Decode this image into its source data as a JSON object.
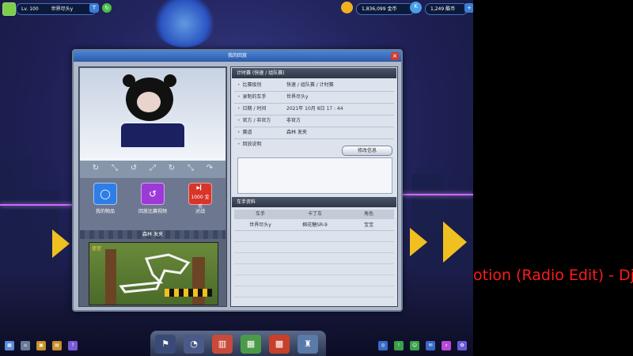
{
  "topbar": {
    "level": "Lv. 100",
    "player_name": "世界尽头y",
    "title_badge": "T",
    "gold": "1,836,099 金币",
    "kcoin": "1,249 酷币",
    "plus": "+"
  },
  "dialog": {
    "title": "我的回放",
    "close": "×",
    "actions": [
      {
        "label": "我的物品",
        "icon": "item-box-icon",
        "color": "#2f7ee6"
      },
      {
        "label": "回放比赛视频",
        "icon": "replay-icon",
        "color": "#9c3ad8"
      },
      {
        "label": "对战",
        "icon": "play-icon",
        "color": "#d8342a",
        "price": "1000 金币"
      }
    ],
    "map_name": "森林 发夹",
    "map_label": "迷宫"
  },
  "info": {
    "header": "计时赛 (快速 / 组队赛)",
    "rows": [
      {
        "key": "比赛级别",
        "value": "快速 / 组队赛 / 计时赛"
      },
      {
        "key": "录制的车手",
        "value": "世界尽头y"
      },
      {
        "key": "日期 / 时间",
        "value": "2021年 10月 8日 17 : 44"
      },
      {
        "key": "官方 / 非官方",
        "value": "非官方"
      },
      {
        "key": "赛道",
        "value": "森林 发夹"
      },
      {
        "key": "回放说明",
        "value": ""
      }
    ],
    "edit_button": "修改信息"
  },
  "drivers": {
    "header": "车手资料",
    "columns": [
      "车手",
      "卡丁车",
      "角色"
    ],
    "rows": [
      {
        "driver": "世界尽头y",
        "kart": "棉花糖SR-9",
        "role": "宝宝"
      }
    ]
  },
  "overlay_text": "otion (Radio Edit) - Dj Ros",
  "colors": {
    "accent": "#2c5aa8",
    "close": "#d23a2a",
    "gold": "#f0c020",
    "marquee": "#ff1a1a"
  }
}
